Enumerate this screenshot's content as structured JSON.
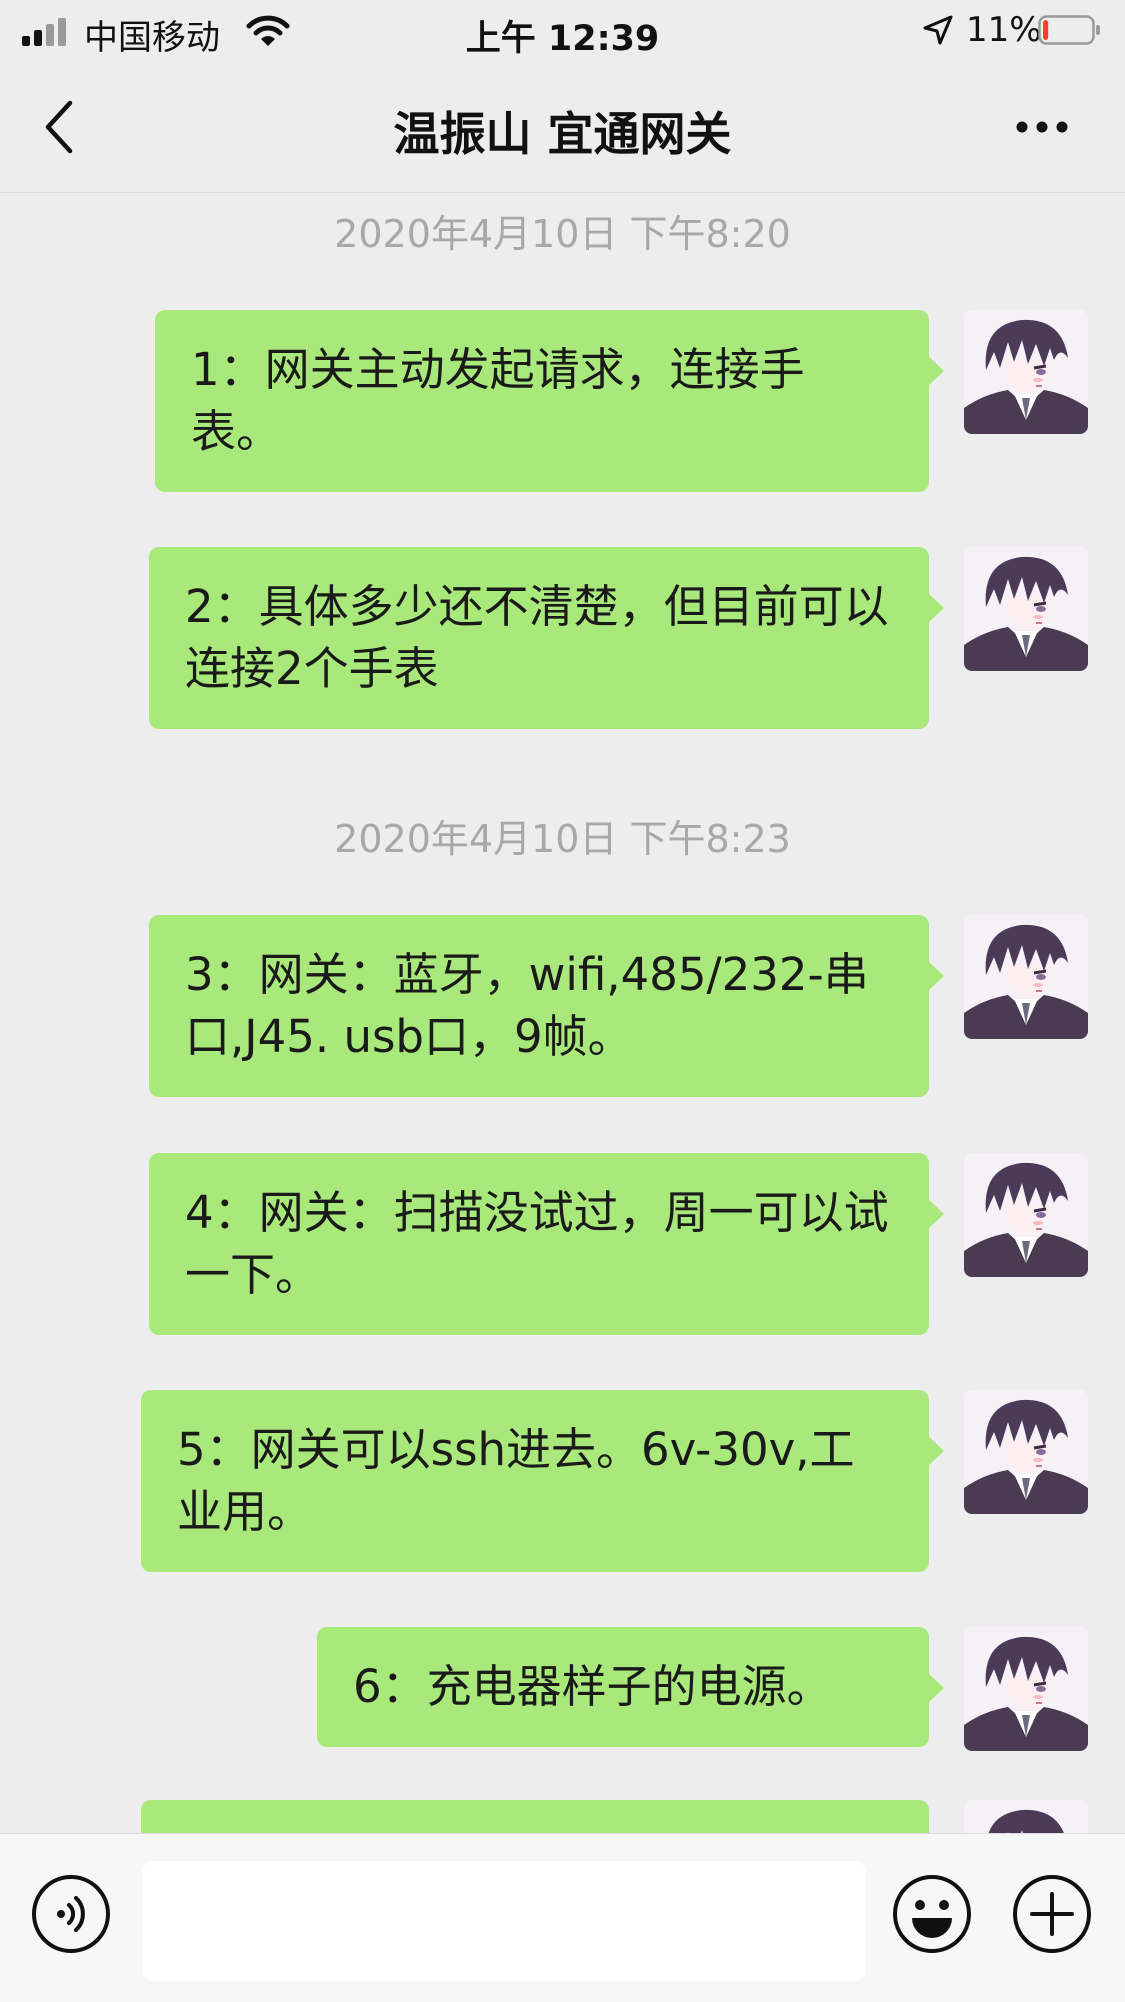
{
  "status_bar": {
    "carrier": "中国移动",
    "time": "上午 12:39",
    "battery": "11%",
    "battery_level": 0.11,
    "battery_color": "#ff3b30",
    "icons": [
      "signal-icon",
      "wifi-icon",
      "location-arrow-icon",
      "battery-icon"
    ]
  },
  "header": {
    "title": "温振山 宜通网关",
    "icons": [
      "back-chevron-icon",
      "more-dots-icon"
    ]
  },
  "chat": {
    "timestamps": [
      "2020年4月10日 下午8:20",
      "2020年4月10日 下午8:23"
    ],
    "messages": [
      {
        "text": "1：网关主动发起请求，连接手表。"
      },
      {
        "text": "2：具体多少还不清楚，但目前可以连接2个手表"
      },
      {
        "text": "3：网关：蓝牙，wifi,485/232-串口,J45. usb口，9帧。"
      },
      {
        "text": "4：网关：扫描没试过，周一可以试一下。"
      },
      {
        "text": "5：网关可以ssh进去。6v-30v,工业用。"
      },
      {
        "text": "6：充电器样子的电源。"
      },
      {
        "text": ""
      }
    ],
    "bubble_color": "#a9e87a"
  },
  "input_bar": {
    "placeholder": "",
    "icons": [
      "voice-icon",
      "emoji-icon",
      "plus-icon"
    ]
  }
}
